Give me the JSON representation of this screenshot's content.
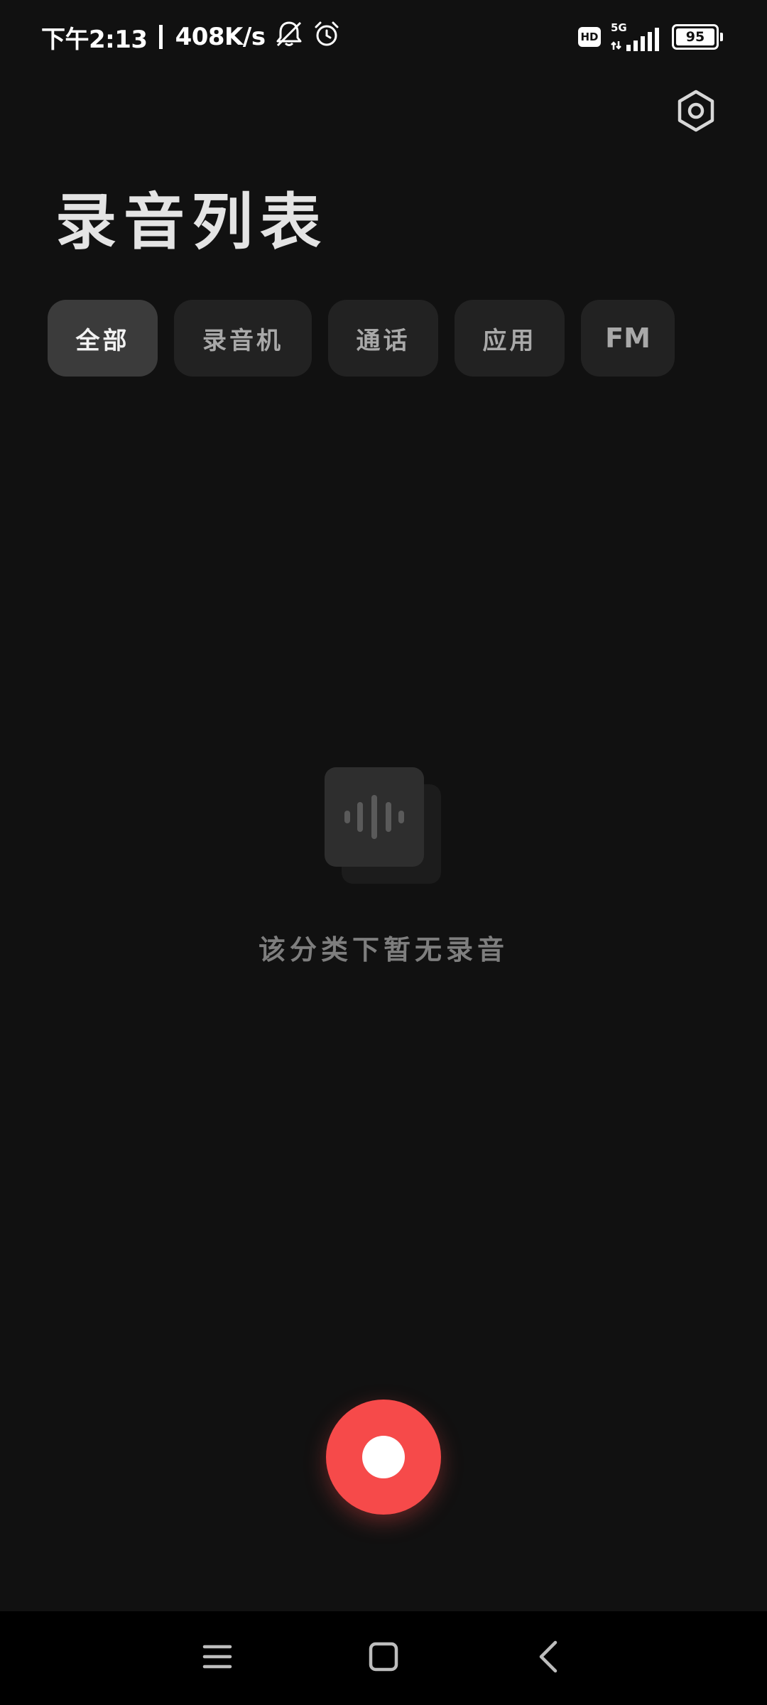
{
  "status_bar": {
    "time": "下午2:13",
    "net_speed": "408K/s",
    "hd_label": "HD",
    "network_type": "5G",
    "battery_percent": 95,
    "battery_label": "95"
  },
  "header": {
    "title": "录音列表",
    "settings_icon": "hexagon-gear-icon"
  },
  "tabs": [
    {
      "label": "全部",
      "active": true
    },
    {
      "label": "录音机",
      "active": false
    },
    {
      "label": "通话",
      "active": false
    },
    {
      "label": "应用",
      "active": false
    },
    {
      "label": "FM",
      "active": false
    }
  ],
  "empty_state": {
    "icon": "audio-wave-icon",
    "message": "该分类下暂无录音"
  },
  "record_button": {
    "icon": "record-dot-icon",
    "color": "#f64a4a"
  },
  "nav_bar": {
    "menu_icon": "menu-icon",
    "home_icon": "home-icon",
    "back_icon": "back-icon"
  },
  "colors": {
    "background": "#111111",
    "tab_active": "#3b3b3b",
    "tab_inactive": "#222222",
    "accent": "#f64a4a"
  }
}
